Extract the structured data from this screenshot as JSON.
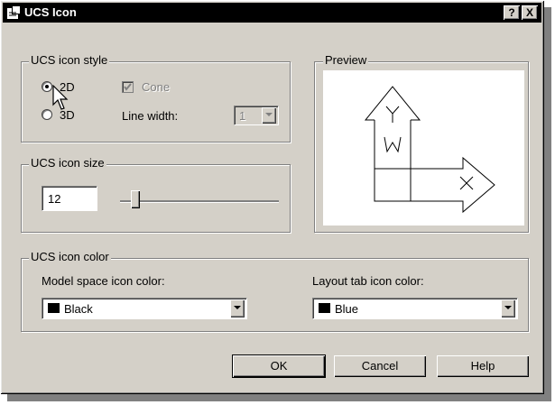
{
  "window": {
    "title": "UCS Icon",
    "help_button": "?",
    "close_button": "X"
  },
  "style_group": {
    "legend": "UCS icon style",
    "radio_2d": "2D",
    "radio_3d": "3D",
    "selected": "2D",
    "cone_label": "Cone",
    "cone_checked": true,
    "cone_enabled": false,
    "line_width_label": "Line width:",
    "line_width_value": "1"
  },
  "preview_group": {
    "legend": "Preview",
    "y_label": "Y",
    "x_label": "X",
    "w_label": "W"
  },
  "size_group": {
    "legend": "UCS icon size",
    "value": "12",
    "slider_fraction": 0.12
  },
  "color_group": {
    "legend": "UCS icon color",
    "model_label": "Model space icon color:",
    "model_value": "Black",
    "model_swatch": "#000000",
    "layout_label": "Layout tab icon color:",
    "layout_value": "Blue",
    "layout_swatch": "#000000"
  },
  "buttons": {
    "ok": "OK",
    "cancel": "Cancel",
    "help": "Help"
  }
}
